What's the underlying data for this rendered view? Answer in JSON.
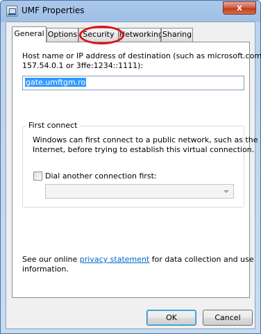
{
  "window": {
    "title": "UMF Properties",
    "close_glyph": "x"
  },
  "tabs": [
    {
      "label": "General",
      "active": true
    },
    {
      "label": "Options",
      "active": false
    },
    {
      "label": "Security",
      "active": false
    },
    {
      "label": "Networking",
      "active": false
    },
    {
      "label": "Sharing",
      "active": false
    }
  ],
  "general": {
    "host_label_line1": "Host name or IP address of destination (such as microsoft.com or",
    "host_label_line2": "157.54.0.1 or 3ffe:1234::1111):",
    "host_value": "gate.umftgm.ro",
    "first_connect": {
      "caption": "First connect",
      "description_line1": "Windows can first connect to a public network, such as the",
      "description_line2": "Internet, before trying to establish this virtual connection.",
      "dial_checkbox_label": "Dial another connection first:",
      "dial_checked": false,
      "dial_combo_value": ""
    },
    "privacy": {
      "prefix": "See our online ",
      "link": "privacy statement",
      "suffix": " for data collection and use",
      "line2": "information."
    }
  },
  "buttons": {
    "ok": "OK",
    "cancel": "Cancel"
  },
  "colors": {
    "annotation": "#e01212",
    "selection": "#3399ff",
    "link": "#0066cc"
  }
}
